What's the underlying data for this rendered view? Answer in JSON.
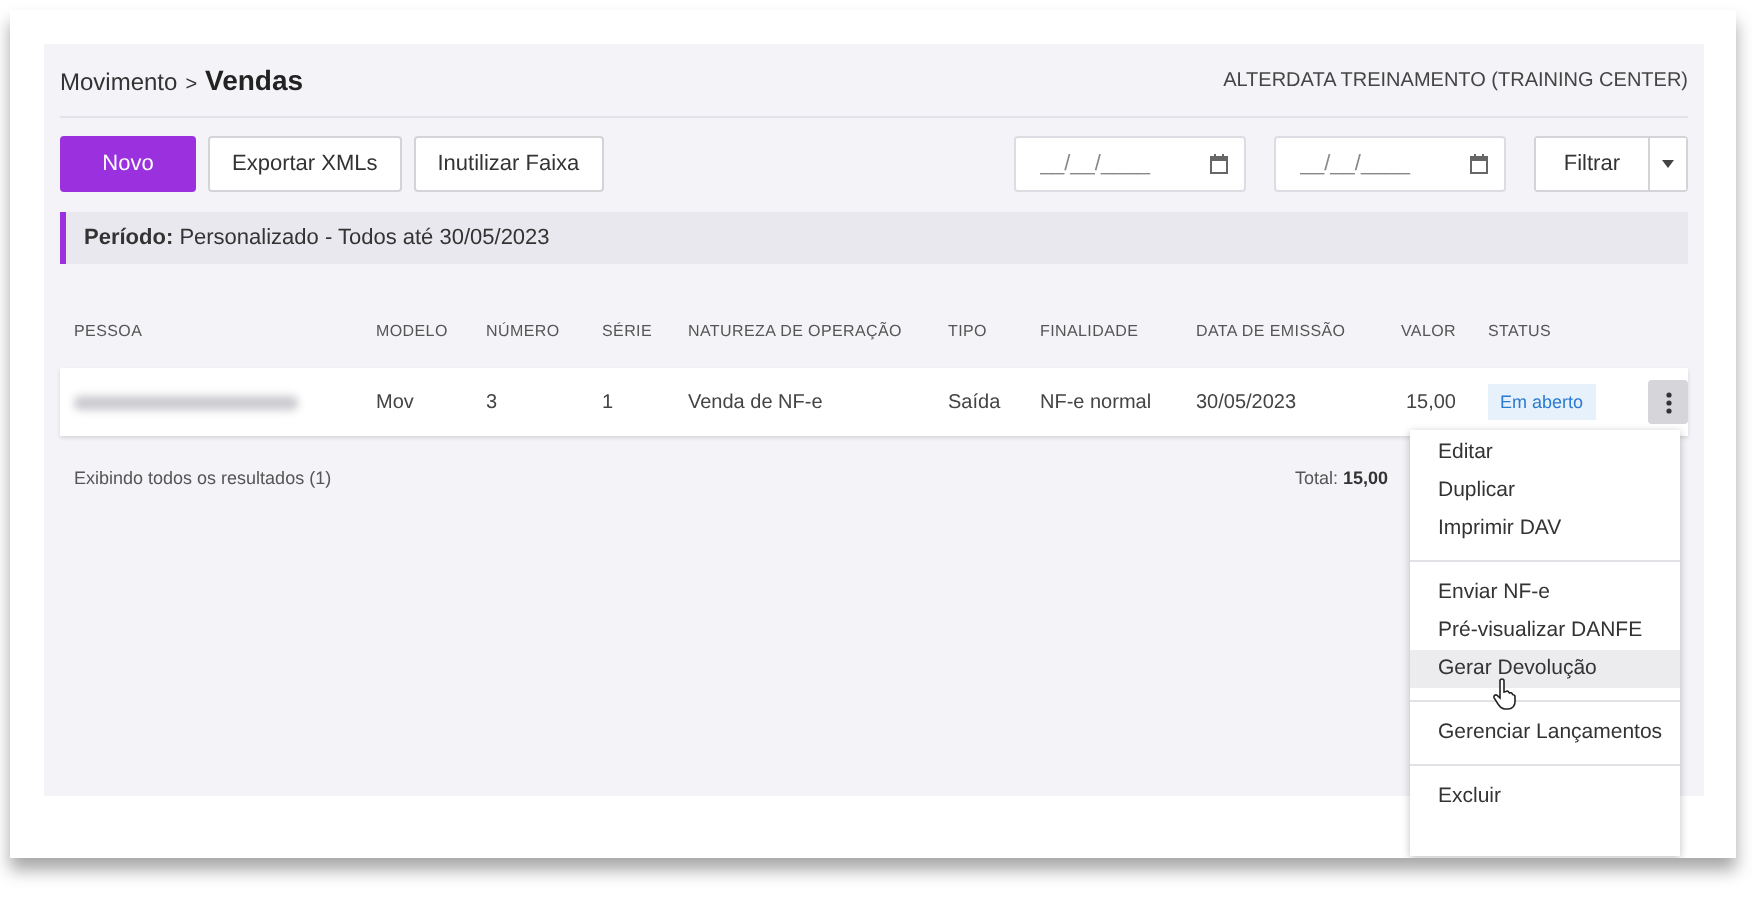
{
  "breadcrumb": {
    "parent": "Movimento",
    "separator": ">",
    "current": "Vendas"
  },
  "company": "ALTERDATA TREINAMENTO (TRAINING CENTER)",
  "buttons": [
    {
      "label": "Novo",
      "kind": "primary"
    },
    {
      "label": "Exportar XMLs",
      "kind": "default"
    },
    {
      "label": "Inutilizar Faixa",
      "kind": "default"
    }
  ],
  "date_fields": [
    {
      "placeholder": "__/__/____"
    },
    {
      "placeholder": "__/__/____"
    }
  ],
  "filter_button": {
    "label": "Filtrar"
  },
  "period": {
    "label": "Período:",
    "value": "Personalizado - Todos até 30/05/2023"
  },
  "table": {
    "columns": [
      "PESSOA",
      "MODELO",
      "NÚMERO",
      "SÉRIE",
      "NATUREZA DE OPERAÇÃO",
      "TIPO",
      "FINALIDADE",
      "DATA DE EMISSÃO",
      "VALOR",
      "STATUS"
    ],
    "rows": [
      {
        "pessoa_blurred": true,
        "modelo": "Mov",
        "numero": "3",
        "serie": "1",
        "natureza": "Venda de NF-e",
        "tipo": "Saída",
        "finalidade": "NF-e normal",
        "data": "30/05/2023",
        "valor": "15,00",
        "status": "Em aberto"
      }
    ]
  },
  "summary": {
    "results": "Exibindo todos os resultados (1)",
    "total_label": "Total:",
    "total_value": "15,00"
  },
  "menu": {
    "groups": [
      [
        {
          "label": "Editar",
          "selected": false
        },
        {
          "label": "Duplicar",
          "selected": false
        },
        {
          "label": "Imprimir DAV",
          "selected": false
        }
      ],
      [
        {
          "label": "Enviar NF-e",
          "selected": false
        },
        {
          "label": "Pré-visualizar DANFE",
          "selected": false
        },
        {
          "label": "Gerar Devolução",
          "selected": true
        }
      ],
      [
        {
          "label": "Gerenciar Lançamentos",
          "selected": false
        }
      ],
      [
        {
          "label": "Excluir",
          "selected": false
        }
      ]
    ]
  }
}
